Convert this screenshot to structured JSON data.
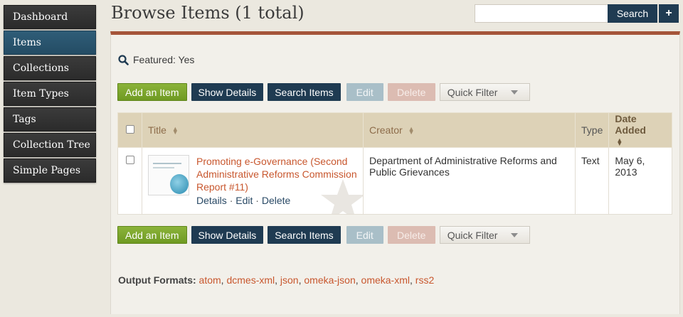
{
  "sidebar": {
    "items": [
      {
        "label": "Dashboard"
      },
      {
        "label": "Items",
        "active": true
      },
      {
        "label": "Collections"
      },
      {
        "label": "Item Types"
      },
      {
        "label": "Tags"
      },
      {
        "label": "Collection Tree"
      },
      {
        "label": "Simple Pages"
      }
    ]
  },
  "header": {
    "title": "Browse Items (1 total)",
    "search_value": "",
    "search_button": "Search",
    "advanced_button": "+"
  },
  "filter": {
    "text": "Featured: Yes"
  },
  "toolbar": {
    "add": "Add an Item",
    "show_details": "Show Details",
    "search_items": "Search Items",
    "edit": "Edit",
    "delete": "Delete",
    "quick_filter": "Quick Filter"
  },
  "table": {
    "headers": {
      "title": "Title",
      "creator": "Creator",
      "type": "Type",
      "date_added": "Date Added"
    },
    "rows": [
      {
        "title": "Promoting e-Governance (Second Administrative Reforms Commission Report #11)",
        "actions": {
          "details": "Details",
          "edit": "Edit",
          "delete": "Delete",
          "separator": "·"
        },
        "creator": "Department of Administrative Reforms and Public Grievances",
        "type": "Text",
        "date_added": "May 6, 2013"
      }
    ]
  },
  "output_formats": {
    "label": "Output Formats:",
    "formats": [
      "atom",
      "dcmes-xml",
      "json",
      "omeka-json",
      "omeka-xml",
      "rss2"
    ]
  },
  "colors": {
    "accent_rule": "#a5553a",
    "nav_bg": "#2f2f2f",
    "nav_active": "#2f5d78",
    "primary_button": "#1f3b52",
    "add_button": "#7aa62a",
    "link": "#c8572e"
  }
}
